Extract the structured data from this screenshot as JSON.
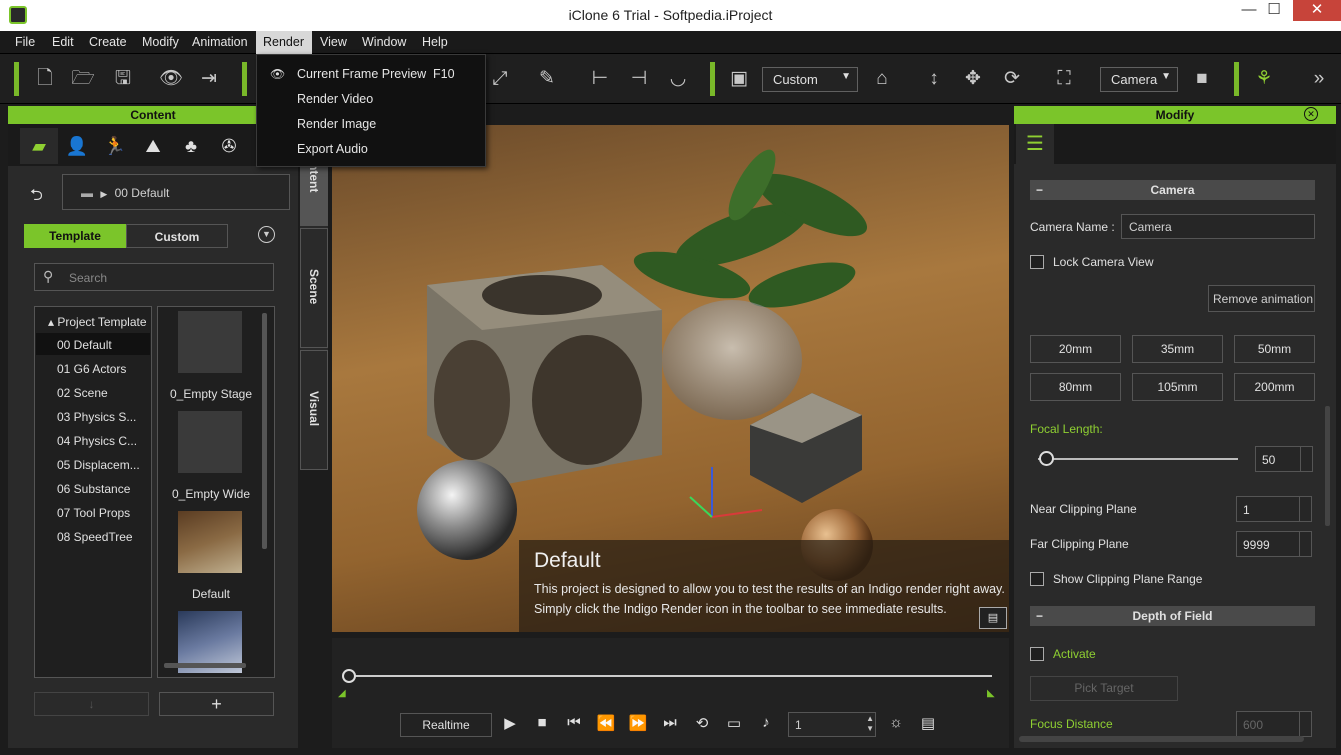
{
  "window": {
    "title": "iClone 6 Trial - Softpedia.iProject",
    "min": "—",
    "max": "☐",
    "close": "✕"
  },
  "menu": {
    "items": [
      "File",
      "Edit",
      "Create",
      "Modify",
      "Animation",
      "Render",
      "View",
      "Window",
      "Help"
    ]
  },
  "render_menu": {
    "items": [
      {
        "label": "Current Frame Preview",
        "shortcut": "F10"
      },
      {
        "label": "Render Video",
        "shortcut": ""
      },
      {
        "label": "Render Image",
        "shortcut": ""
      },
      {
        "label": "Export Audio",
        "shortcut": ""
      }
    ]
  },
  "toolbar": {
    "view_select": "Custom",
    "camera_select": "Camera"
  },
  "content": {
    "header": "Content",
    "path": "00 Default",
    "tabs": [
      "Template",
      "Custom"
    ],
    "search_placeholder": "Search",
    "tree_root": "Project Template",
    "tree_items": [
      "00 Default",
      "01 G6 Actors",
      "02 Scene",
      "03 Physics S...",
      "04 Physics C...",
      "05 Displacem...",
      "06 Substance",
      "07 Tool Props",
      "08 SpeedTree"
    ],
    "thumbs": [
      "0_Empty Stage",
      "0_Empty Wide",
      "Default"
    ]
  },
  "side_tabs": [
    "Content",
    "Scene",
    "Visual"
  ],
  "viewport": {
    "info_title": "Default",
    "info_line1": "This project is designed to allow you to test the results of an Indigo render right away.",
    "info_line2": "Simply click the Indigo Render icon in the toolbar to see immediate results."
  },
  "timeline": {
    "mode": "Realtime",
    "frame": "1"
  },
  "modify": {
    "header": "Modify",
    "camera_section": "Camera",
    "camera_name_label": "Camera Name :",
    "camera_name": "Camera",
    "lock_label": "Lock Camera View",
    "remove_anim": "Remove  animation",
    "lenses": [
      "20mm",
      "35mm",
      "50mm",
      "80mm",
      "105mm",
      "200mm"
    ],
    "focal_label": "Focal Length:",
    "focal_value": "50",
    "focal_fraction": 0.04,
    "near_label": "Near Clipping Plane",
    "near_value": "1",
    "far_label": "Far Clipping Plane",
    "far_value": "9999",
    "show_clip_label": "Show Clipping Plane Range",
    "dof_section": "Depth of Field",
    "activate_label": "Activate",
    "pick_target": "Pick Target",
    "focus_label": "Focus Distance",
    "focus_value": "600"
  }
}
